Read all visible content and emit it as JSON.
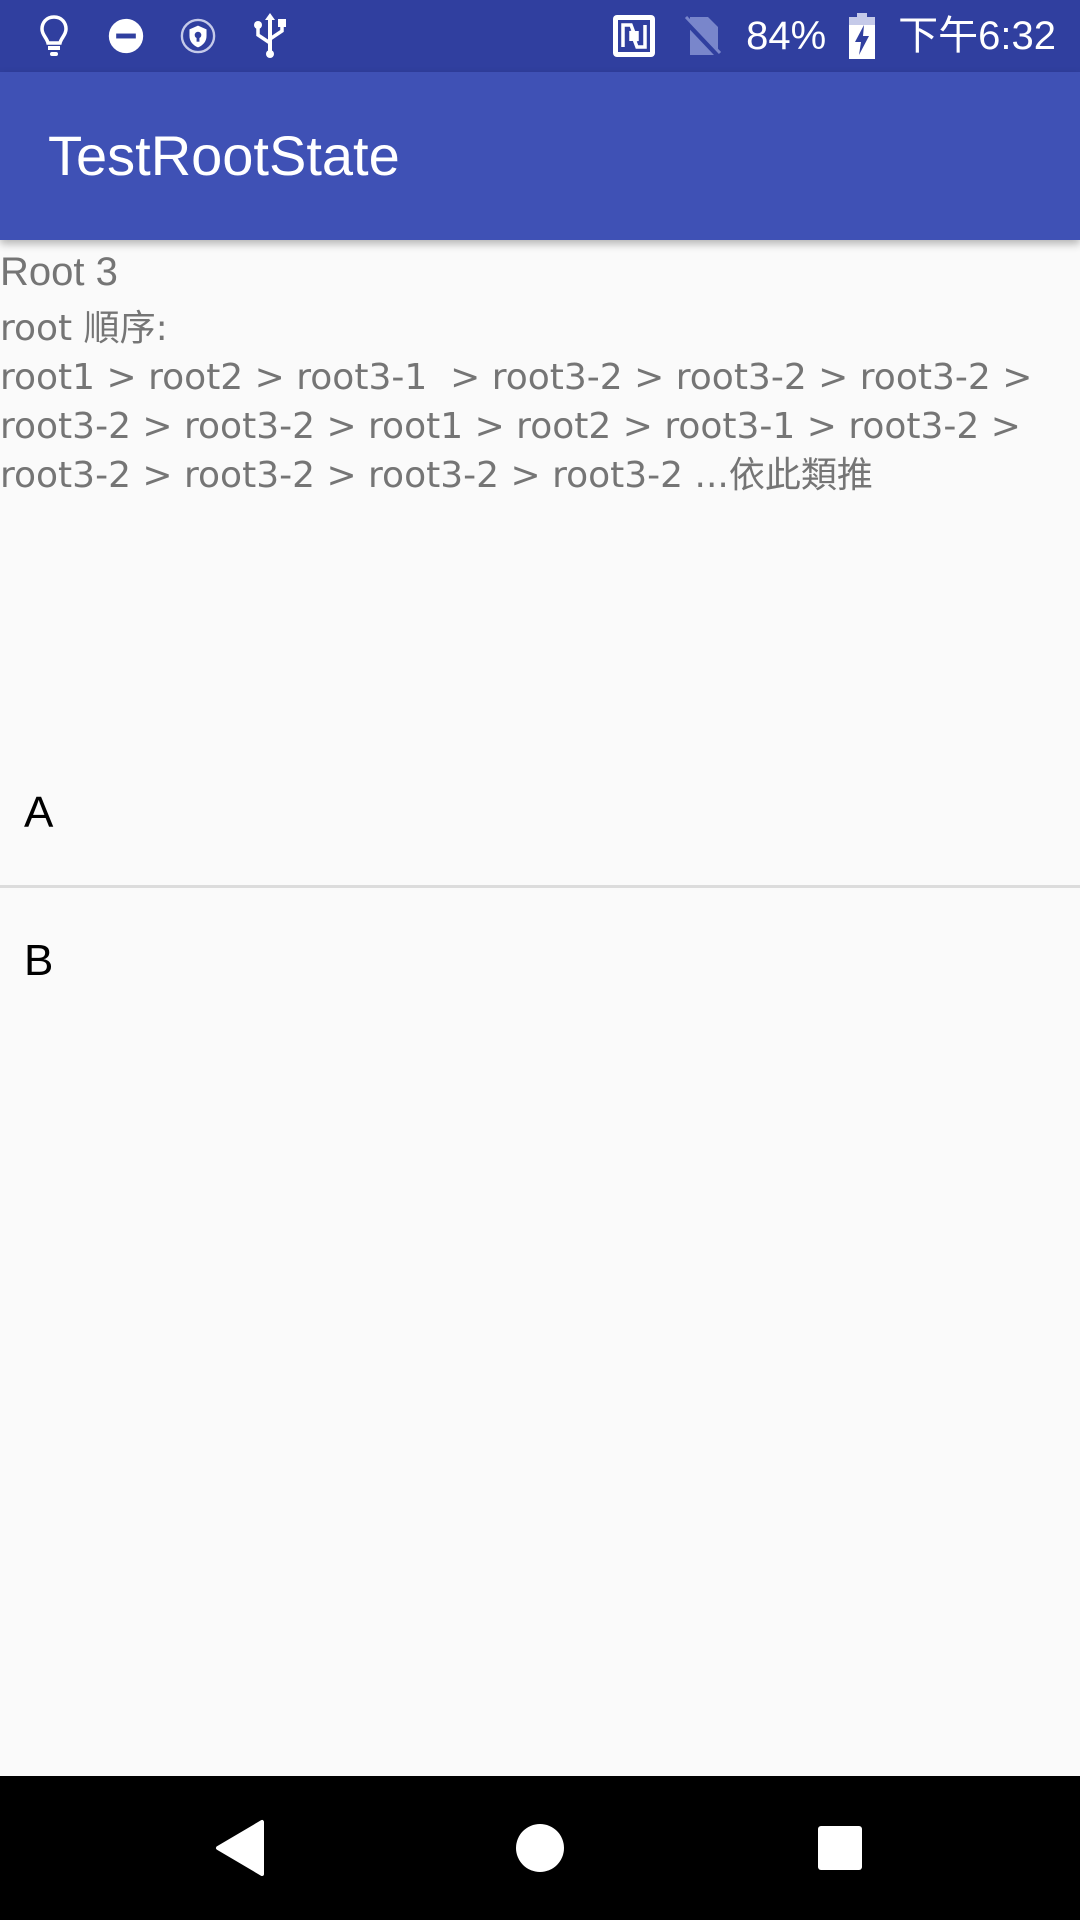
{
  "status_bar": {
    "battery_percent": "84%",
    "time": "下午6:32",
    "icons": [
      "lightbulb-icon",
      "do-not-disturb-icon",
      "vpn-shield-icon",
      "usb-icon",
      "nfc-icon",
      "no-sim-icon",
      "battery-charging-icon"
    ]
  },
  "app_bar": {
    "title": "TestRootState"
  },
  "content": {
    "root_title": "Root 3",
    "order_label": "root 順序:",
    "order_line_1": "root1 > root2 > root3-1  > root3-2 > root3-2 > root3-2 >",
    "order_line_2": "root3-2 > root3-2 > root1 > root2 > root3-1 > root3-2 >",
    "order_line_3": "root3-2 > root3-2 > root3-2 > root3-2 ...依此類推"
  },
  "list": {
    "items": [
      {
        "label": "A"
      },
      {
        "label": "B"
      }
    ]
  },
  "nav_bar": {
    "buttons": [
      "back-icon",
      "home-icon",
      "recents-icon"
    ]
  },
  "colors": {
    "status_bar": "#303f9f",
    "app_bar": "#3f51b5",
    "background": "#fafafa",
    "secondary_text": "#757575"
  }
}
